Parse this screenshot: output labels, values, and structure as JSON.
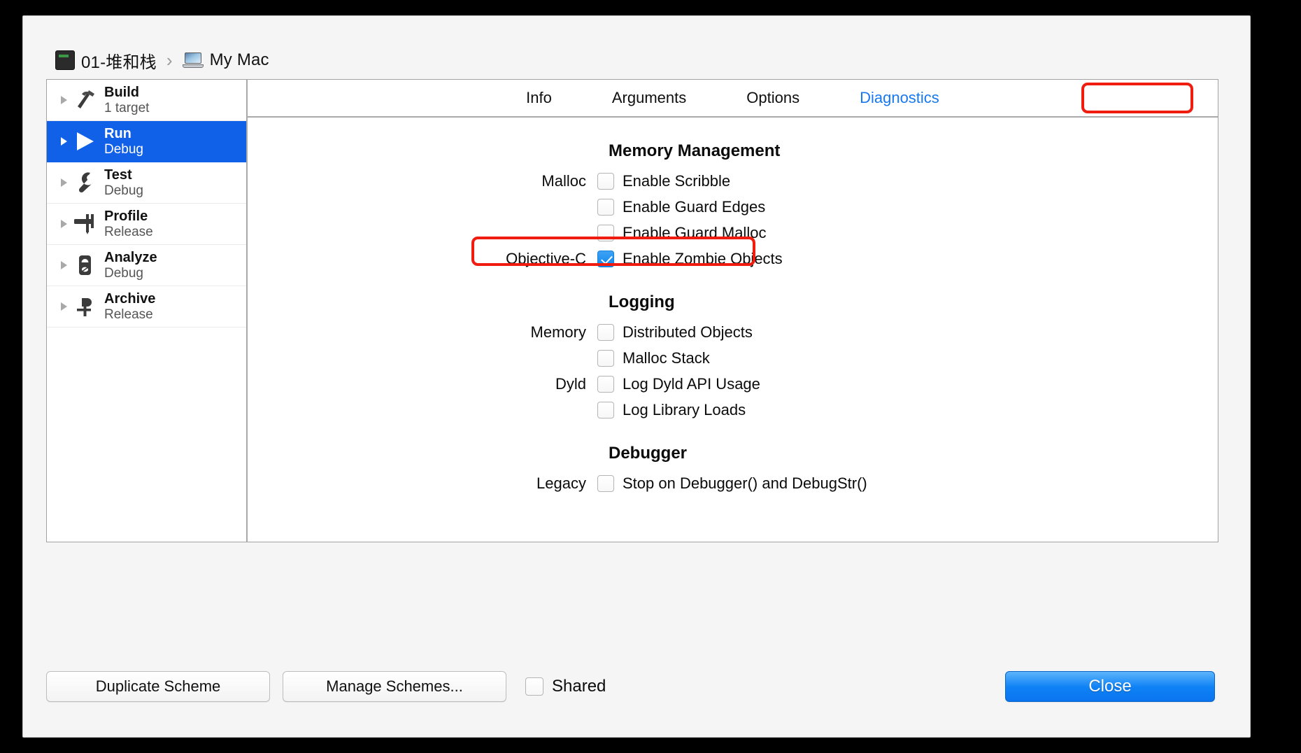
{
  "window": {
    "breadcrumb": {
      "project_icon": "project-icon",
      "project_label": "01-堆和栈",
      "separator": "›",
      "device_icon": "mac-laptop-icon",
      "device_label": "My Mac"
    }
  },
  "sidebar": {
    "items": [
      {
        "title": "Build",
        "subtitle": "1 target",
        "icon": "hammer-icon",
        "selected": false
      },
      {
        "title": "Run",
        "subtitle": "Debug",
        "icon": "play-icon",
        "selected": true
      },
      {
        "title": "Test",
        "subtitle": "Debug",
        "icon": "wrench-icon",
        "selected": false
      },
      {
        "title": "Profile",
        "subtitle": "Release",
        "icon": "caliper-icon",
        "selected": false
      },
      {
        "title": "Analyze",
        "subtitle": "Debug",
        "icon": "analyze-icon",
        "selected": false
      },
      {
        "title": "Archive",
        "subtitle": "Release",
        "icon": "archive-icon",
        "selected": false
      }
    ]
  },
  "tabs": [
    {
      "label": "Info",
      "active": false
    },
    {
      "label": "Arguments",
      "active": false
    },
    {
      "label": "Options",
      "active": false
    },
    {
      "label": "Diagnostics",
      "active": true
    }
  ],
  "sections": {
    "memory_management": {
      "title": "Memory Management",
      "rows": [
        {
          "label": "Malloc",
          "checkbox": "Enable Scribble",
          "checked": false
        },
        {
          "label": "",
          "checkbox": "Enable Guard Edges",
          "checked": false
        },
        {
          "label": "",
          "checkbox": "Enable Guard Malloc",
          "checked": false
        },
        {
          "label": "Objective-C",
          "checkbox": "Enable Zombie Objects",
          "checked": true
        }
      ]
    },
    "logging": {
      "title": "Logging",
      "rows": [
        {
          "label": "Memory",
          "checkbox": "Distributed Objects",
          "checked": false
        },
        {
          "label": "",
          "checkbox": "Malloc Stack",
          "checked": false
        },
        {
          "label": "Dyld",
          "checkbox": "Log Dyld API Usage",
          "checked": false
        },
        {
          "label": "",
          "checkbox": "Log Library Loads",
          "checked": false
        }
      ]
    },
    "debugger": {
      "title": "Debugger",
      "rows": [
        {
          "label": "Legacy",
          "checkbox": "Stop on Debugger() and DebugStr()",
          "checked": false
        }
      ]
    }
  },
  "footer": {
    "duplicate_label": "Duplicate Scheme",
    "manage_label": "Manage Schemes...",
    "shared_label": "Shared",
    "shared_checked": false,
    "close_label": "Close"
  },
  "annotations": {
    "highlight_color": "#f01c10",
    "targets": [
      "Diagnostics tab",
      "Enable Zombie Objects row"
    ]
  },
  "colors": {
    "selection_blue": "#1060e8",
    "accent_blue": "#1878f0",
    "checkbox_blue": "#1188ec",
    "highlight_red": "#f01c10"
  }
}
